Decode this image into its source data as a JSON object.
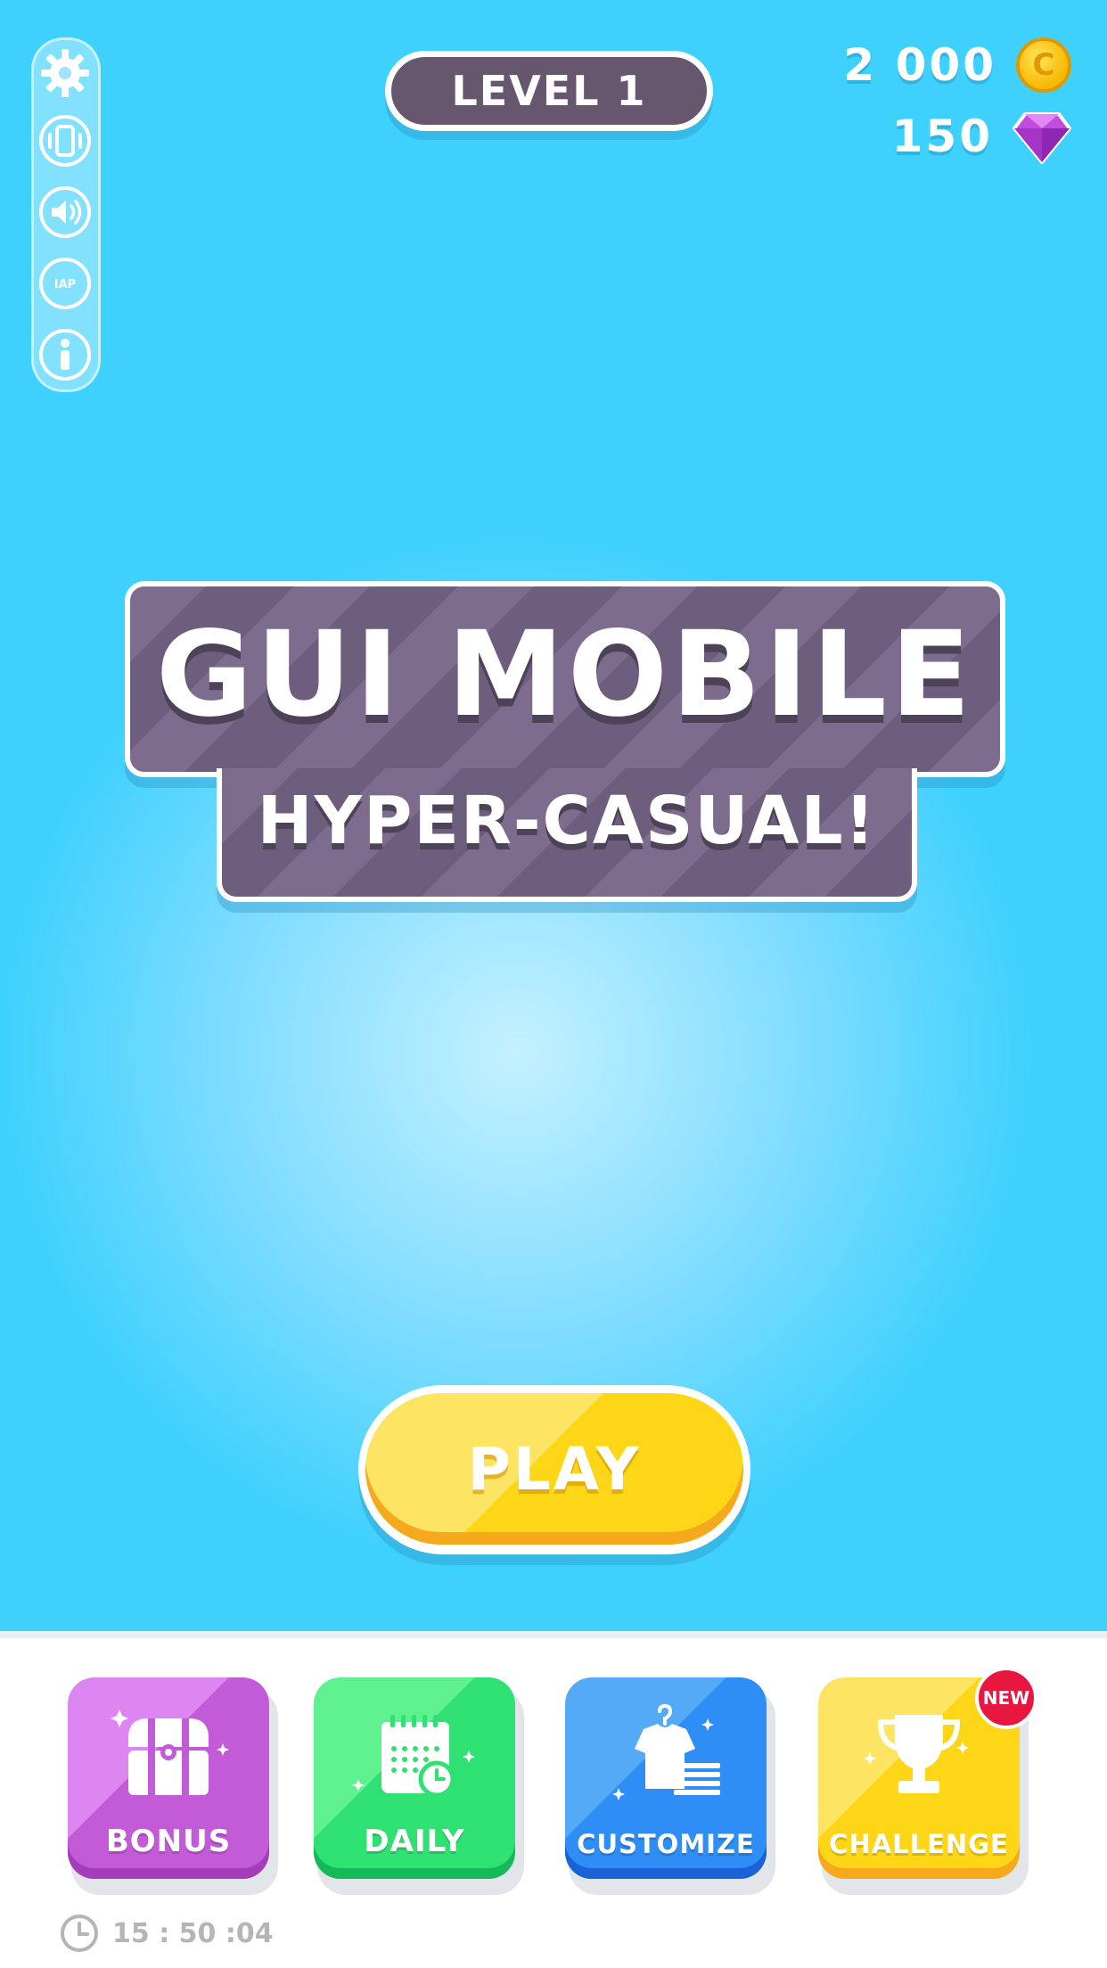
{
  "level": {
    "label": "LEVEL 1"
  },
  "currency": {
    "coins": "2 000",
    "gems": "150",
    "coin_glyph": "C"
  },
  "title": {
    "main": "GUI MOBILE",
    "sub": "HYPER-CASUAL!"
  },
  "play_label": "PLAY",
  "settings_rail": {
    "icons": [
      "gear-icon",
      "vibration-icon",
      "sound-icon",
      "iap-icon",
      "info-icon"
    ],
    "iap_text": "IAP"
  },
  "dock": {
    "tiles": [
      {
        "label": "BONUS",
        "icon": "chest-icon",
        "color": "#c35ad8"
      },
      {
        "label": "DAILY",
        "icon": "calendar-icon",
        "color": "#2fe173"
      },
      {
        "label": "CUSTOMIZE",
        "icon": "shirt-icon",
        "color": "#2f8ef5"
      },
      {
        "label": "CHALLENGE",
        "icon": "trophy-icon",
        "color": "#fcd617"
      }
    ],
    "new_badge": "NEW",
    "timer": "15 : 50 :04"
  },
  "colors": {
    "background": "#3fd1fd",
    "banner": "#6e5e7e",
    "play": "#fcd617"
  }
}
